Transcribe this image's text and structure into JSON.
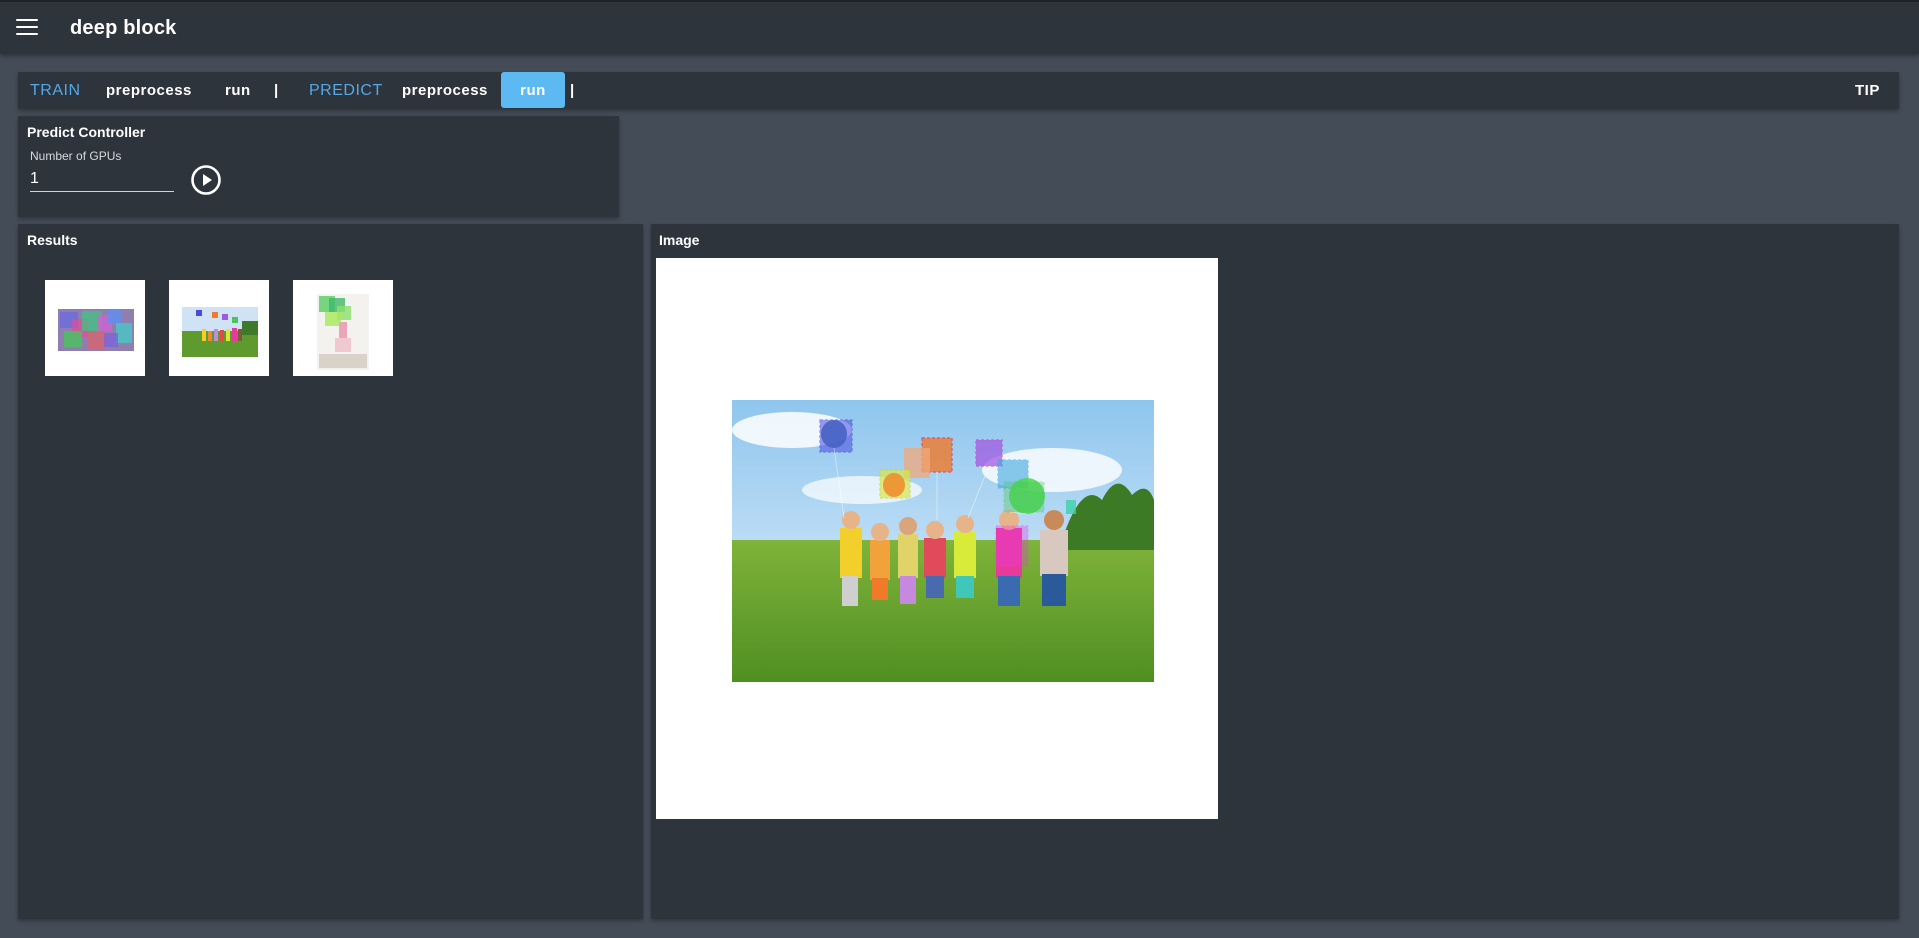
{
  "app": {
    "title": "deep block"
  },
  "toolbar": {
    "train_label": "TRAIN",
    "train_preprocess": "preprocess",
    "train_run": "run",
    "separator": "|",
    "predict_label": "PREDICT",
    "predict_preprocess": "preprocess",
    "predict_run": "run",
    "tip": "TIP"
  },
  "controller": {
    "title": "Predict Controller",
    "gpus_label": "Number of GPUs",
    "gpus_value": "1"
  },
  "results": {
    "title": "Results",
    "thumbnails": [
      "result-1",
      "result-2",
      "result-3"
    ]
  },
  "image_panel": {
    "title": "Image"
  },
  "colors": {
    "appbar": "#2e343c",
    "background": "#444c57",
    "accent": "#52a8e8",
    "active_button": "#5cb9f2"
  },
  "icons": [
    "menu-icon",
    "play-circle-icon"
  ]
}
